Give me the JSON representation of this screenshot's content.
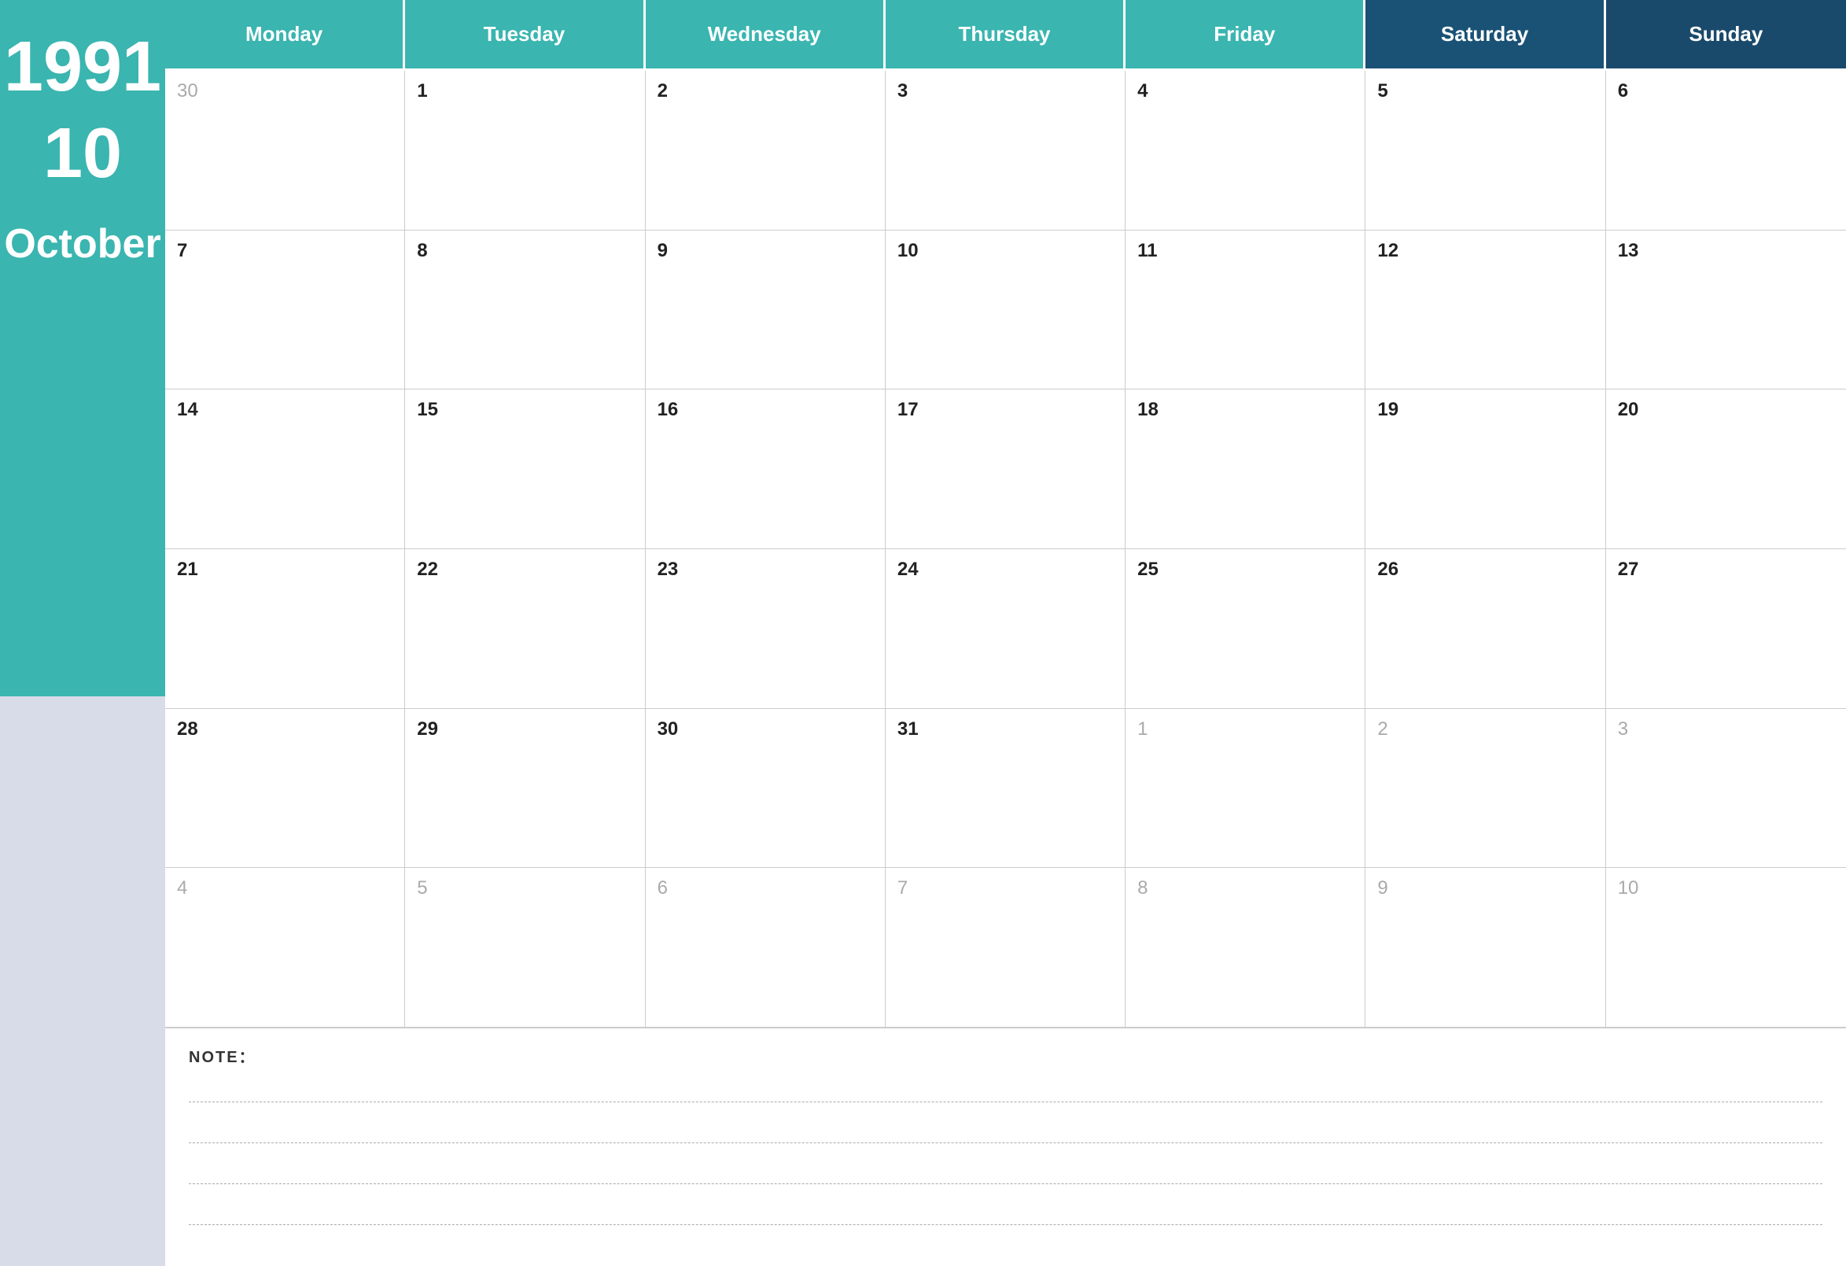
{
  "sidebar": {
    "year": "1991",
    "month_number": "10",
    "month_name": "October"
  },
  "header": {
    "days": [
      {
        "label": "Monday",
        "type": "weekday"
      },
      {
        "label": "Tuesday",
        "type": "weekday"
      },
      {
        "label": "Wednesday",
        "type": "weekday"
      },
      {
        "label": "Thursday",
        "type": "weekday"
      },
      {
        "label": "Friday",
        "type": "weekday"
      },
      {
        "label": "Saturday",
        "type": "saturday"
      },
      {
        "label": "Sunday",
        "type": "sunday"
      }
    ]
  },
  "weeks": [
    [
      {
        "day": "30",
        "outside": true
      },
      {
        "day": "1",
        "outside": false
      },
      {
        "day": "2",
        "outside": false
      },
      {
        "day": "3",
        "outside": false
      },
      {
        "day": "4",
        "outside": false
      },
      {
        "day": "5",
        "outside": false
      },
      {
        "day": "6",
        "outside": false
      }
    ],
    [
      {
        "day": "7",
        "outside": false
      },
      {
        "day": "8",
        "outside": false
      },
      {
        "day": "9",
        "outside": false
      },
      {
        "day": "10",
        "outside": false
      },
      {
        "day": "11",
        "outside": false
      },
      {
        "day": "12",
        "outside": false
      },
      {
        "day": "13",
        "outside": false
      }
    ],
    [
      {
        "day": "14",
        "outside": false
      },
      {
        "day": "15",
        "outside": false
      },
      {
        "day": "16",
        "outside": false
      },
      {
        "day": "17",
        "outside": false
      },
      {
        "day": "18",
        "outside": false
      },
      {
        "day": "19",
        "outside": false
      },
      {
        "day": "20",
        "outside": false
      }
    ],
    [
      {
        "day": "21",
        "outside": false
      },
      {
        "day": "22",
        "outside": false
      },
      {
        "day": "23",
        "outside": false
      },
      {
        "day": "24",
        "outside": false
      },
      {
        "day": "25",
        "outside": false
      },
      {
        "day": "26",
        "outside": false
      },
      {
        "day": "27",
        "outside": false
      }
    ],
    [
      {
        "day": "28",
        "outside": false
      },
      {
        "day": "29",
        "outside": false
      },
      {
        "day": "30",
        "outside": false
      },
      {
        "day": "31",
        "outside": false
      },
      {
        "day": "1",
        "outside": true
      },
      {
        "day": "2",
        "outside": true
      },
      {
        "day": "3",
        "outside": true
      }
    ],
    [
      {
        "day": "4",
        "outside": true
      },
      {
        "day": "5",
        "outside": true
      },
      {
        "day": "6",
        "outside": true
      },
      {
        "day": "7",
        "outside": true
      },
      {
        "day": "8",
        "outside": true
      },
      {
        "day": "9",
        "outside": true
      },
      {
        "day": "10",
        "outside": true
      }
    ]
  ],
  "notes": {
    "label": "NOTE：",
    "line_count": 4
  }
}
